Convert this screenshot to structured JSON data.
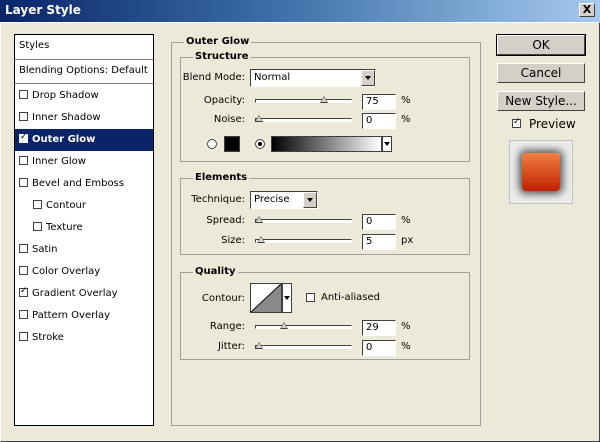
{
  "window": {
    "title": "Layer Style",
    "close_glyph": "X"
  },
  "sidebar": {
    "header": "Styles",
    "blending": "Blending Options: Default",
    "items": [
      {
        "label": "Drop Shadow",
        "checked": false
      },
      {
        "label": "Inner Shadow",
        "checked": false
      },
      {
        "label": "Outer Glow",
        "checked": true,
        "selected": true
      },
      {
        "label": "Inner Glow",
        "checked": false
      },
      {
        "label": "Bevel and Emboss",
        "checked": false
      },
      {
        "label": "Contour",
        "checked": false
      },
      {
        "label": "Texture",
        "checked": false
      },
      {
        "label": "Satin",
        "checked": false
      },
      {
        "label": "Color Overlay",
        "checked": false
      },
      {
        "label": "Gradient Overlay",
        "checked": true
      },
      {
        "label": "Pattern Overlay",
        "checked": false
      },
      {
        "label": "Stroke",
        "checked": false
      }
    ]
  },
  "panel": {
    "title": "Outer Glow",
    "structure": {
      "title": "Structure",
      "blend_mode_label": "Blend Mode:",
      "blend_mode_value": "Normal",
      "opacity_label": "Opacity:",
      "opacity_value": "75",
      "opacity_fraction": 0.75,
      "opacity_unit": "%",
      "noise_label": "Noise:",
      "noise_value": "0",
      "noise_fraction": 0,
      "noise_unit": "%",
      "glow_color": "#000000"
    },
    "elements": {
      "title": "Elements",
      "technique_label": "Technique:",
      "technique_value": "Precise",
      "spread_label": "Spread:",
      "spread_value": "0",
      "spread_fraction": 0,
      "spread_unit": "%",
      "size_label": "Size:",
      "size_value": "5",
      "size_fraction": 0.02,
      "size_unit": "px"
    },
    "quality": {
      "title": "Quality",
      "contour_label": "Contour:",
      "antialiased_label": "Anti-aliased",
      "antialiased": false,
      "range_label": "Range:",
      "range_value": "29",
      "range_fraction": 0.29,
      "range_unit": "%",
      "jitter_label": "Jitter:",
      "jitter_value": "0",
      "jitter_fraction": 0,
      "jitter_unit": "%"
    }
  },
  "buttons": {
    "ok": "OK",
    "cancel": "Cancel",
    "new_style": "New Style...",
    "preview_label": "Preview",
    "preview_checked": true
  }
}
